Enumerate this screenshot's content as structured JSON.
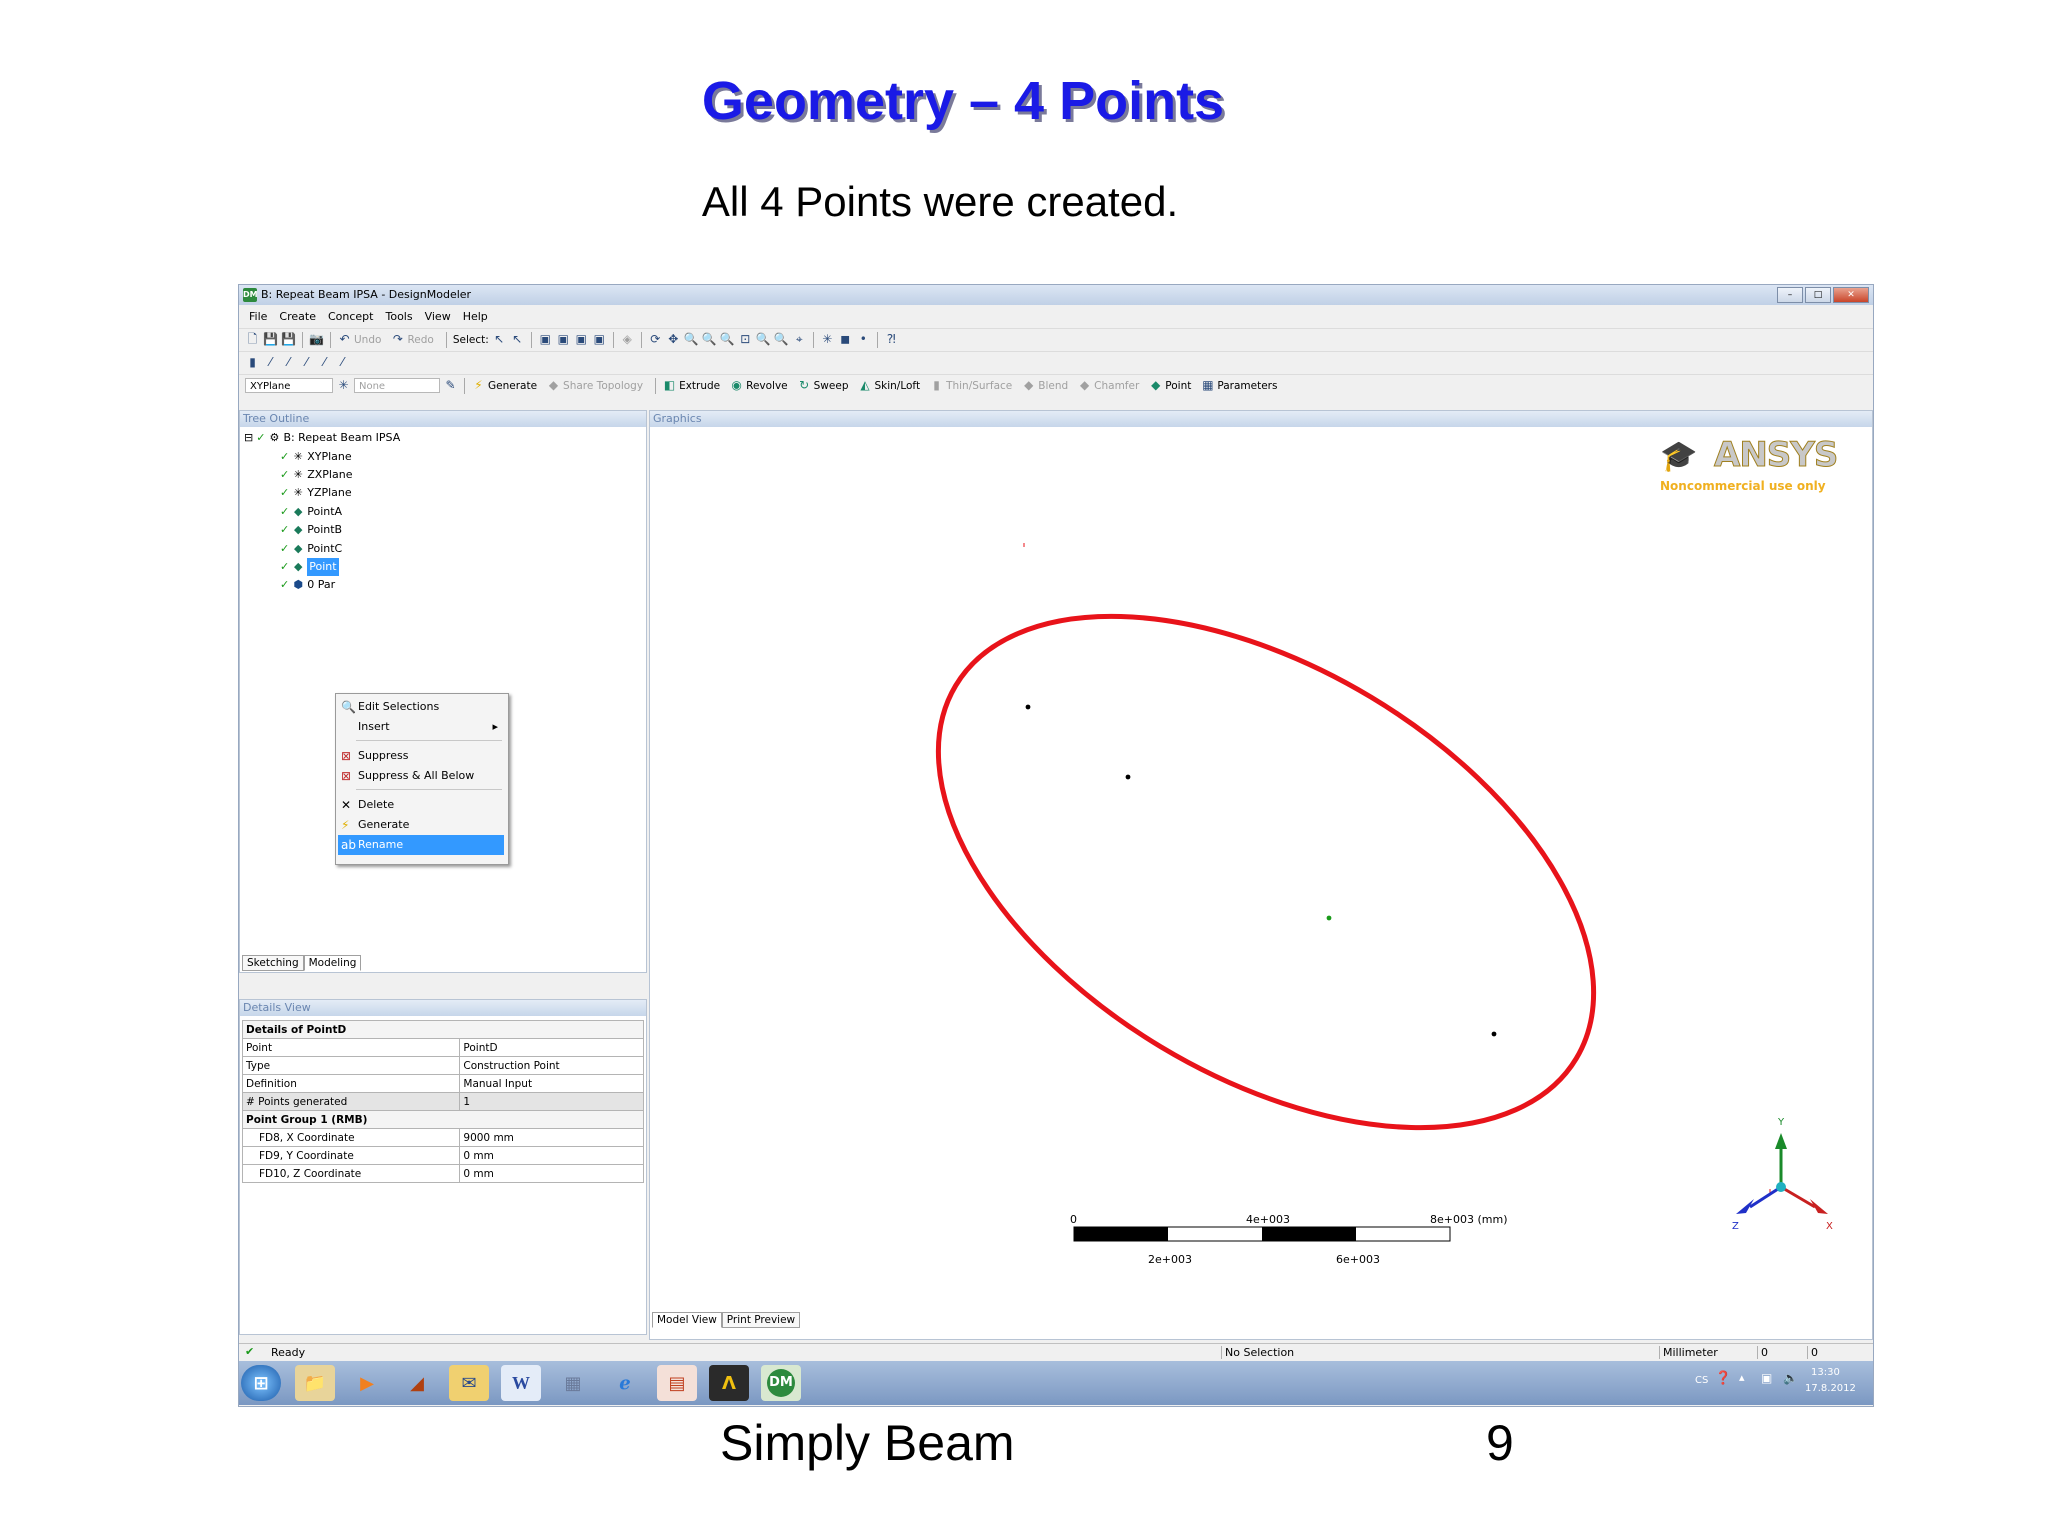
{
  "slide": {
    "title": "Geometry – 4 Points",
    "subtitle": "All 4 Points were created.",
    "footer_left": "Simply Beam",
    "page_number": "9"
  },
  "window": {
    "title": "B: Repeat Beam IPSA - DesignModeler",
    "app_icon": "DM",
    "buttons": {
      "minimize": "–",
      "maximize": "□",
      "close": "✕"
    }
  },
  "menu": [
    "File",
    "Create",
    "Concept",
    "Tools",
    "View",
    "Help"
  ],
  "toolbar1": {
    "undo": "Undo",
    "redo": "Redo",
    "select": "Select:"
  },
  "toolbar3": {
    "plane_select": "XYPlane",
    "sketch_select": "None",
    "generate": "Generate",
    "share_topology": "Share Topology",
    "extrude": "Extrude",
    "revolve": "Revolve",
    "sweep": "Sweep",
    "skin_loft": "Skin/Loft",
    "thin_surface": "Thin/Surface",
    "blend": "Blend",
    "chamfer": "Chamfer",
    "point": "Point",
    "parameters": "Parameters"
  },
  "tree": {
    "header": "Tree Outline",
    "root": "B: Repeat Beam IPSA",
    "items": [
      "XYPlane",
      "ZXPlane",
      "YZPlane",
      "PointA",
      "PointB",
      "PointC",
      "Point",
      "0 Par"
    ]
  },
  "context_menu": {
    "items": [
      "Edit Selections",
      "Insert",
      "Suppress",
      "Suppress & All Below",
      "Delete",
      "Generate",
      "Rename"
    ],
    "highlighted": "Rename"
  },
  "tree_tabs": [
    "Sketching",
    "Modeling"
  ],
  "details": {
    "header": "Details View",
    "group1": "Details of PointD",
    "rows1": [
      [
        "Point",
        "PointD"
      ],
      [
        "Type",
        "Construction Point"
      ],
      [
        "Definition",
        "Manual Input"
      ],
      [
        "# Points generated",
        "1"
      ]
    ],
    "group2": "Point Group 1  (RMB)",
    "rows2": [
      [
        "FD8, X Coordinate",
        "9000 mm"
      ],
      [
        "FD9, Y Coordinate",
        "0 mm"
      ],
      [
        "FD10, Z Coordinate",
        "0 mm"
      ]
    ]
  },
  "graphics": {
    "header": "Graphics",
    "logo": "ANSYS",
    "logo_note": "Noncommercial use only",
    "scale_labels_top": [
      "0",
      "4e+003",
      "8e+003 (mm)"
    ],
    "scale_labels_bottom": [
      "2e+003",
      "6e+003"
    ],
    "axes": {
      "x": "X",
      "y": "Y",
      "z": "Z"
    },
    "tabs": [
      "Model View",
      "Print Preview"
    ],
    "highlight_color": "#e8131a"
  },
  "status": {
    "ready": "Ready",
    "selection": "No Selection",
    "units": "Millimeter",
    "v1": "0",
    "v2": "0"
  },
  "taskbar": {
    "lang": "CS",
    "time": "13:30",
    "date": "17.8.2012",
    "apps": [
      "start",
      "explorer",
      "media",
      "matlab",
      "outlook",
      "W",
      "calc",
      "ie",
      "powerpoint",
      "ansys",
      "DM"
    ]
  }
}
